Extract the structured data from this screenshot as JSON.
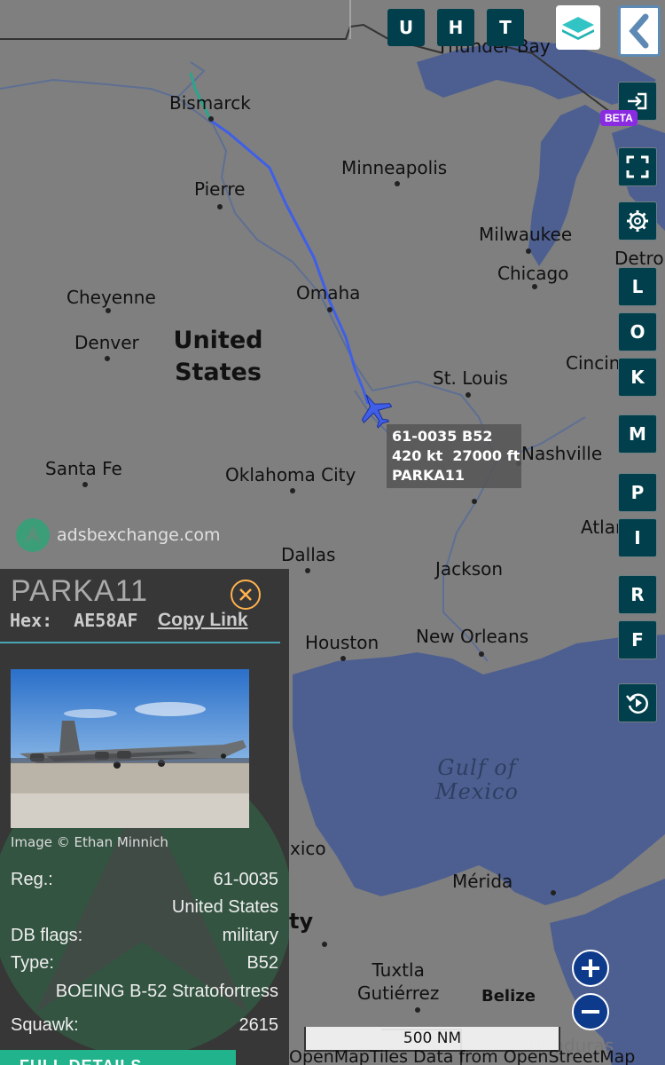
{
  "map": {
    "cities": [
      {
        "id": "thunder-bay",
        "label": "Thunder Bay"
      },
      {
        "id": "bismarck",
        "label": "Bismarck"
      },
      {
        "id": "minneapolis",
        "label": "Minneapolis"
      },
      {
        "id": "pierre",
        "label": "Pierre"
      },
      {
        "id": "milwaukee",
        "label": "Milwaukee"
      },
      {
        "id": "chicago",
        "label": "Chicago"
      },
      {
        "id": "detroit",
        "label": "Detro"
      },
      {
        "id": "cheyenne",
        "label": "Cheyenne"
      },
      {
        "id": "omaha",
        "label": "Omaha"
      },
      {
        "id": "denver",
        "label": "Denver"
      },
      {
        "id": "cincinnati",
        "label": "Cincin"
      },
      {
        "id": "st-louis",
        "label": "St. Louis"
      },
      {
        "id": "nashville",
        "label": "Nashville"
      },
      {
        "id": "santa-fe",
        "label": "Santa Fe"
      },
      {
        "id": "oklahoma-city",
        "label": "Oklahoma City"
      },
      {
        "id": "atlanta",
        "label": "Atlan"
      },
      {
        "id": "dallas",
        "label": "Dallas"
      },
      {
        "id": "jackson",
        "label": "Jackson"
      },
      {
        "id": "houston",
        "label": "Houston"
      },
      {
        "id": "new-orleans",
        "label": "New Orleans"
      },
      {
        "id": "mexico",
        "label": "xico"
      },
      {
        "id": "merida",
        "label": "Mérida"
      },
      {
        "id": "mexico-city",
        "label": "ty"
      },
      {
        "id": "tuxtla",
        "label": "Tuxtla\nGutiérrez"
      },
      {
        "id": "belize",
        "label": "Belize"
      },
      {
        "id": "honduras",
        "label": "Honduras"
      }
    ],
    "country_label": "United\nStates",
    "water_label": "Gulf of\nMexico",
    "colors": {
      "land": "#7f7f7f",
      "water": "#4d5f91",
      "track": "#3f5fe8",
      "track_start": "#2ba58d"
    }
  },
  "toolbar": {
    "top_buttons": [
      "U",
      "H",
      "T"
    ],
    "layers_icon": "layers-icon",
    "back_icon": "chevron-left-icon"
  },
  "side_buttons": {
    "login_icon": "login-icon",
    "beta_badge": "BETA",
    "fullscreen_icon": "fullscreen-icon",
    "settings_icon": "gear-icon",
    "letters": [
      "L",
      "O",
      "K",
      "M",
      "P",
      "I",
      "R",
      "F"
    ],
    "replay_icon": "replay-icon"
  },
  "aircraft_label": {
    "line1": "61-0035 B52",
    "line2": "420 kt  27000 ft",
    "line3": "PARKA11"
  },
  "watermark": {
    "text": "adsbexchange.com"
  },
  "info_panel": {
    "callsign": "PARKA11",
    "hex_label": "Hex:",
    "hex_value": "AE58AF",
    "copy_link": "Copy Link",
    "photo_credit": "Image © Ethan Minnich",
    "reg_label": "Reg.:",
    "reg_value": "61-0035",
    "country": "United States",
    "db_flags_label": "DB flags:",
    "db_flags_value": "military",
    "type_label": "Type:",
    "type_value": "B52",
    "type_full": "BOEING B-52 Stratofortress",
    "squawk_label": "Squawk:",
    "squawk_value": "2615",
    "full_details": "FULL DETAILS"
  },
  "zoom": {
    "in_icon": "plus-icon",
    "out_icon": "minus-icon"
  },
  "scale_bar": "500 NM",
  "attribution": "OpenMapTiles Data from OpenStreetMap"
}
